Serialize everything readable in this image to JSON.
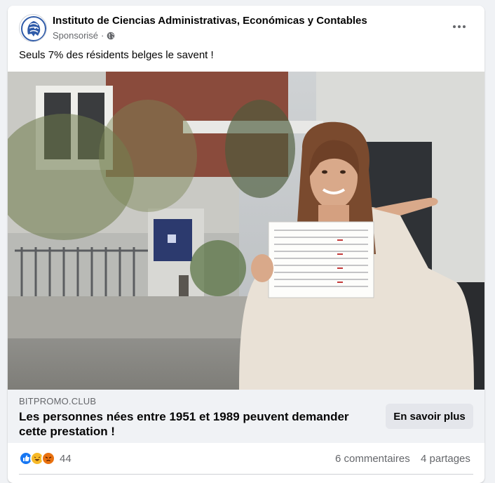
{
  "post": {
    "page_name": "Instituto de Ciencias Administrativas, Económicas y Contables",
    "sponsored": "Sponsorisé",
    "separator": "·",
    "text": "Seuls 7% des résidents belges le savent !"
  },
  "link": {
    "domain": "BITPROMO.CLUB",
    "headline": "Les personnes nées entre 1951 et 1989 peuvent demander cette prestation !",
    "cta": "En savoir plus"
  },
  "engagement": {
    "reaction_icons": [
      "like-icon",
      "haha-icon",
      "angry-icon"
    ],
    "reactions_count": "44",
    "comments": "6 commentaires",
    "shares": "4 partages"
  },
  "colors": {
    "like": "#1877f2",
    "haha": "#f7b928",
    "angry": "#e9710f",
    "button_bg": "#e4e6eb",
    "link_bar_bg": "#f0f2f5"
  }
}
